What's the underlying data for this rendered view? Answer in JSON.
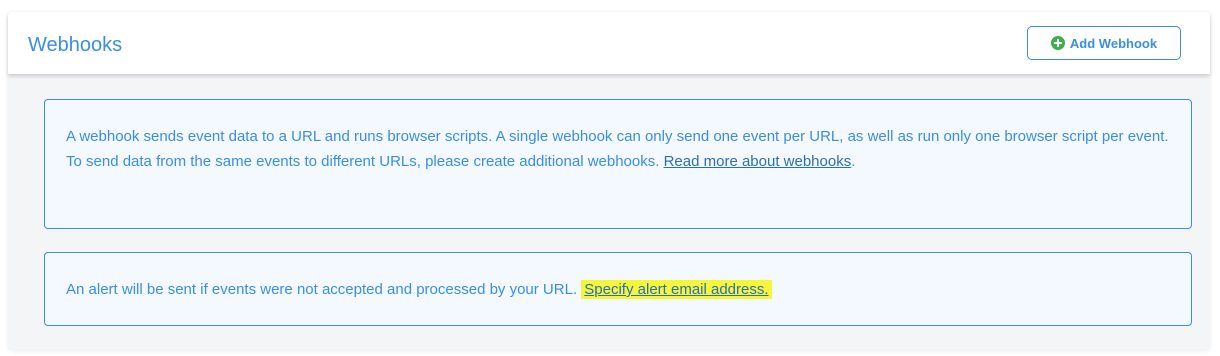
{
  "header": {
    "title": "Webhooks",
    "add_button_label": "Add Webhook",
    "add_icon": "plus-circle-icon"
  },
  "info_box": {
    "text_before_link": "A webhook sends event data to a URL and runs browser scripts. A single webhook can only send one event per URL, as well as run only one browser script per event. To send data from the same events to different URLs, please create additional webhooks. ",
    "link_text": "Read more about webhooks",
    "text_after_link": "."
  },
  "alert_box": {
    "text_before_link": "An alert will be sent if events were not accepted and processed by your URL. ",
    "link_text": "Specify alert email address."
  },
  "colors": {
    "accent": "#3a8ee6",
    "success_icon": "#3cb04a",
    "highlight": "#f5f53a"
  }
}
